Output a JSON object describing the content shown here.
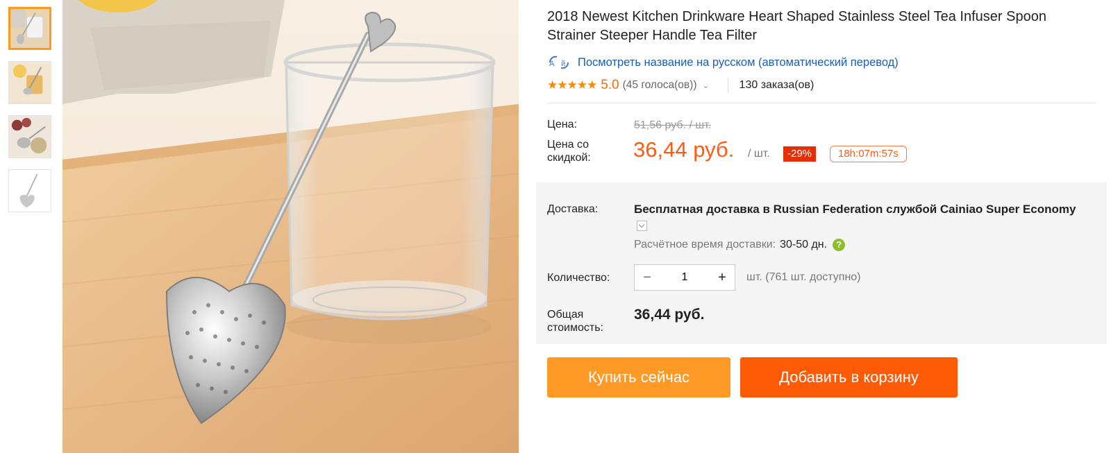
{
  "product": {
    "title": "2018 Newest Kitchen Drinkware Heart Shaped Stainless Steel Tea Infuser Spoon Strainer Steeper Handle Tea Filter",
    "translate_link": "Посмотреть название на русском (автоматический перевод)",
    "rating": {
      "value": "5.0",
      "votes": "(45 голоса(ов))",
      "orders": "130 заказа(ов)",
      "stars": 5
    }
  },
  "price": {
    "label": "Цена:",
    "old": "51,56 руб. / шт.",
    "discount_label_1": "Цена со",
    "discount_label_2": "скидкой:",
    "new": "36,44 руб.",
    "per_unit": "/ шт.",
    "discount_badge": "-29%",
    "timer": "18h:07m:57s"
  },
  "shipping": {
    "label": "Доставка:",
    "text": "Бесплатная доставка в Russian Federation службой Cainiao Super Economy",
    "eta_label": "Расчётное время доставки:",
    "eta_value": "30-50  дн."
  },
  "quantity": {
    "label": "Количество:",
    "value": "1",
    "minus": "−",
    "plus": "+",
    "availability": "шт. (761 шт. доступно)"
  },
  "total": {
    "label_1": "Общая",
    "label_2": "стоимость:",
    "value": "36,44 руб."
  },
  "actions": {
    "buy_now": "Купить сейчас",
    "add_to_cart": "Добавить в корзину"
  },
  "colors": {
    "accent": "#ff5b12",
    "buy_button": "#ff9a26",
    "cart_button": "#ff5a05",
    "discount_badge": "#e62e04",
    "link": "#1a5fb4",
    "star": "#ff8a00"
  },
  "icons": {
    "translate": "translate-icon",
    "help": "help-icon"
  }
}
